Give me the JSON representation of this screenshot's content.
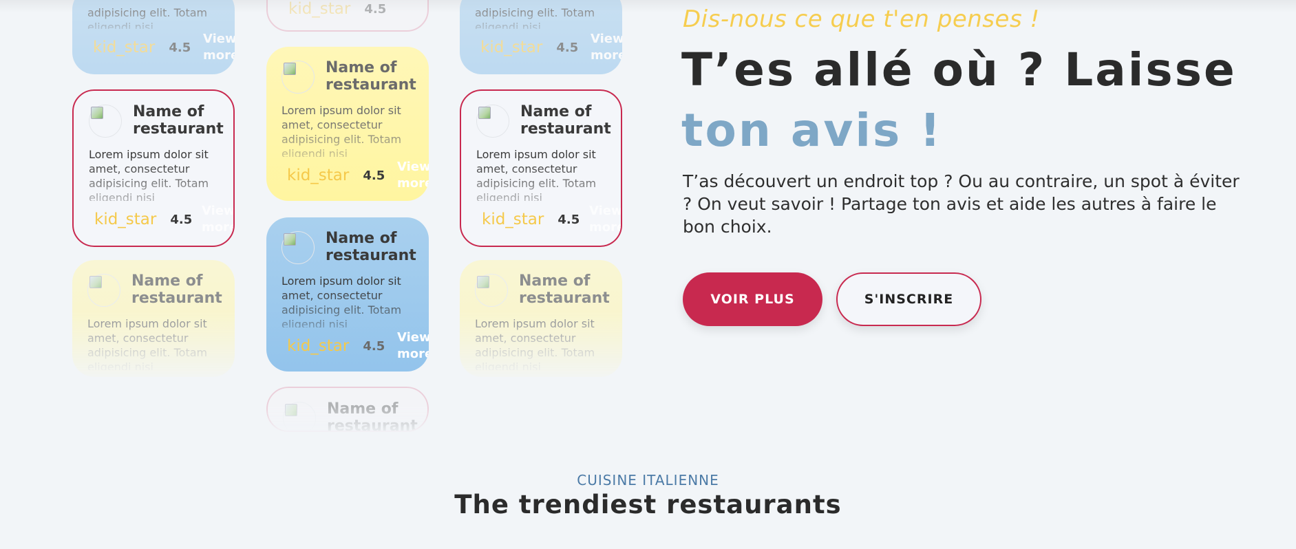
{
  "hero": {
    "eyebrow": "Dis-nous ce que t'en penses !",
    "title_part1": "T’es allé où ? Laisse",
    "title_accent": "ton avis !",
    "description": "T’as découvert un endroit top ? Ou au contraire, un spot à éviter ? On veut savoir ! Partage ton avis et aide les autres à faire le bon choix.",
    "primary_button": "VOIR PLUS",
    "secondary_button": "S'INSCRIRE"
  },
  "card_template": {
    "title": "Name of restaurant",
    "description": "Lorem ipsum dolor sit amet, consectetur adipisicing elit. Totam eligendi nisi",
    "partial_description": "adipisicing elit. Totam eligendi nisi",
    "icon_text": "kid_star",
    "rating": "4.5",
    "more_label": "View more"
  },
  "section": {
    "eyebrow": "CUISINE ITALIENNE",
    "title": "The trendiest restaurants"
  },
  "colors": {
    "accent_red": "#c8294f",
    "accent_blue": "#7ea7c6",
    "star_yellow": "#f5c94a",
    "card_blue": "#93c4ec",
    "card_yellow": "#fff5a0"
  }
}
